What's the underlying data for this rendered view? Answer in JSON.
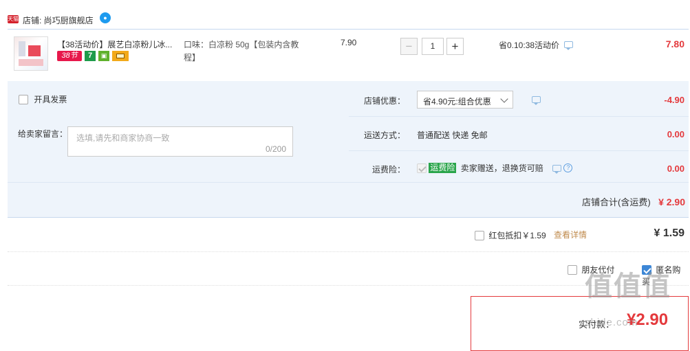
{
  "shop": {
    "badge": "天猫",
    "name": "店铺: 尚巧厨旗舰店",
    "ww_icon": "aliwangwang-icon"
  },
  "item": {
    "title": "【38活动价】展艺白凉粉儿冰...",
    "badges": [
      "38节",
      "7"
    ],
    "sku": "口味：白凉粉 50g【包装内含教程】",
    "unit_price": "7.90",
    "quantity": "1",
    "minus": "−",
    "plus": "+",
    "promo": "省0.10:38活动价",
    "total": "7.80"
  },
  "order": {
    "invoice_label": "开具发票",
    "note_label": "给卖家留言：",
    "note_placeholder": "选填,请先和商家协商一致",
    "note_count": "0/200",
    "discount_label": "店铺优惠：",
    "discount_value": "省4.90元:组合优惠",
    "discount_amount": "-4.90",
    "shipping_label": "运送方式：",
    "shipping_value": "普通配送 快递 免邮",
    "shipping_amount": "0.00",
    "insurance_label": "运费险：",
    "insurance_tag": "运费险",
    "insurance_text": "卖家赠送，退换货可赔",
    "insurance_amount": "0.00",
    "shop_total_label": "店铺合计(含运费)",
    "shop_total_amount": "¥ 2.90"
  },
  "redpacket": {
    "label": "红包抵扣￥1.59",
    "detail_link": "查看详情",
    "amount": "¥ 1.59"
  },
  "options": {
    "friend_pay": "朋友代付",
    "anonymous": "匿名购买",
    "anonymous_checked": true
  },
  "payment": {
    "label": "实付款：",
    "amount": "¥2.90"
  },
  "watermark": {
    "logo": "值值值",
    "site": "zhide.com"
  },
  "colors": {
    "accent": "#e4393c",
    "panel": "#eef4fb",
    "link": "#c08b4e"
  }
}
